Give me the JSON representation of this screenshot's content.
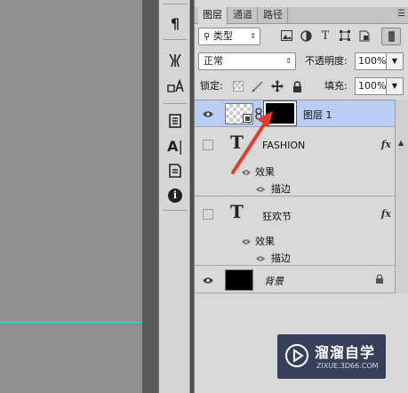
{
  "panel": {
    "tabs": [
      "图层",
      "通道",
      "路径"
    ],
    "active_tab": "图层"
  },
  "filter": {
    "kind_label": "类型"
  },
  "blend": {
    "mode": "正常",
    "opacity_label": "不透明度:",
    "opacity_value": "100%",
    "lock_label": "锁定:",
    "fill_label": "填充:",
    "fill_value": "100%"
  },
  "layers": [
    {
      "name": "图层 1",
      "type": "pixel-with-mask",
      "visible": true,
      "selected": true
    },
    {
      "name": "FASHION",
      "type": "text",
      "visible": false,
      "fx": "fx",
      "effects_label": "效果",
      "effects": [
        "描边"
      ]
    },
    {
      "name": "狂欢节",
      "type": "text",
      "visible": false,
      "fx": "fx",
      "effects_label": "效果",
      "effects": [
        "描边"
      ]
    },
    {
      "name": "背景",
      "type": "background",
      "visible": true,
      "locked": true
    }
  ],
  "text_layer_glyph": "T",
  "fx_glyph": "fx",
  "toolstrip": {
    "glyphs": {
      "paragraph": "¶",
      "character": "A",
      "info": "i"
    }
  },
  "watermark": {
    "title": "溜溜自学",
    "url": "ZIXUE.3D66.COM"
  },
  "colors": {
    "selected_row": "#b9cdf5",
    "guide": "#3fd7e8",
    "arrow": "#e8392e",
    "panel_bg": "#d9d9d9"
  }
}
